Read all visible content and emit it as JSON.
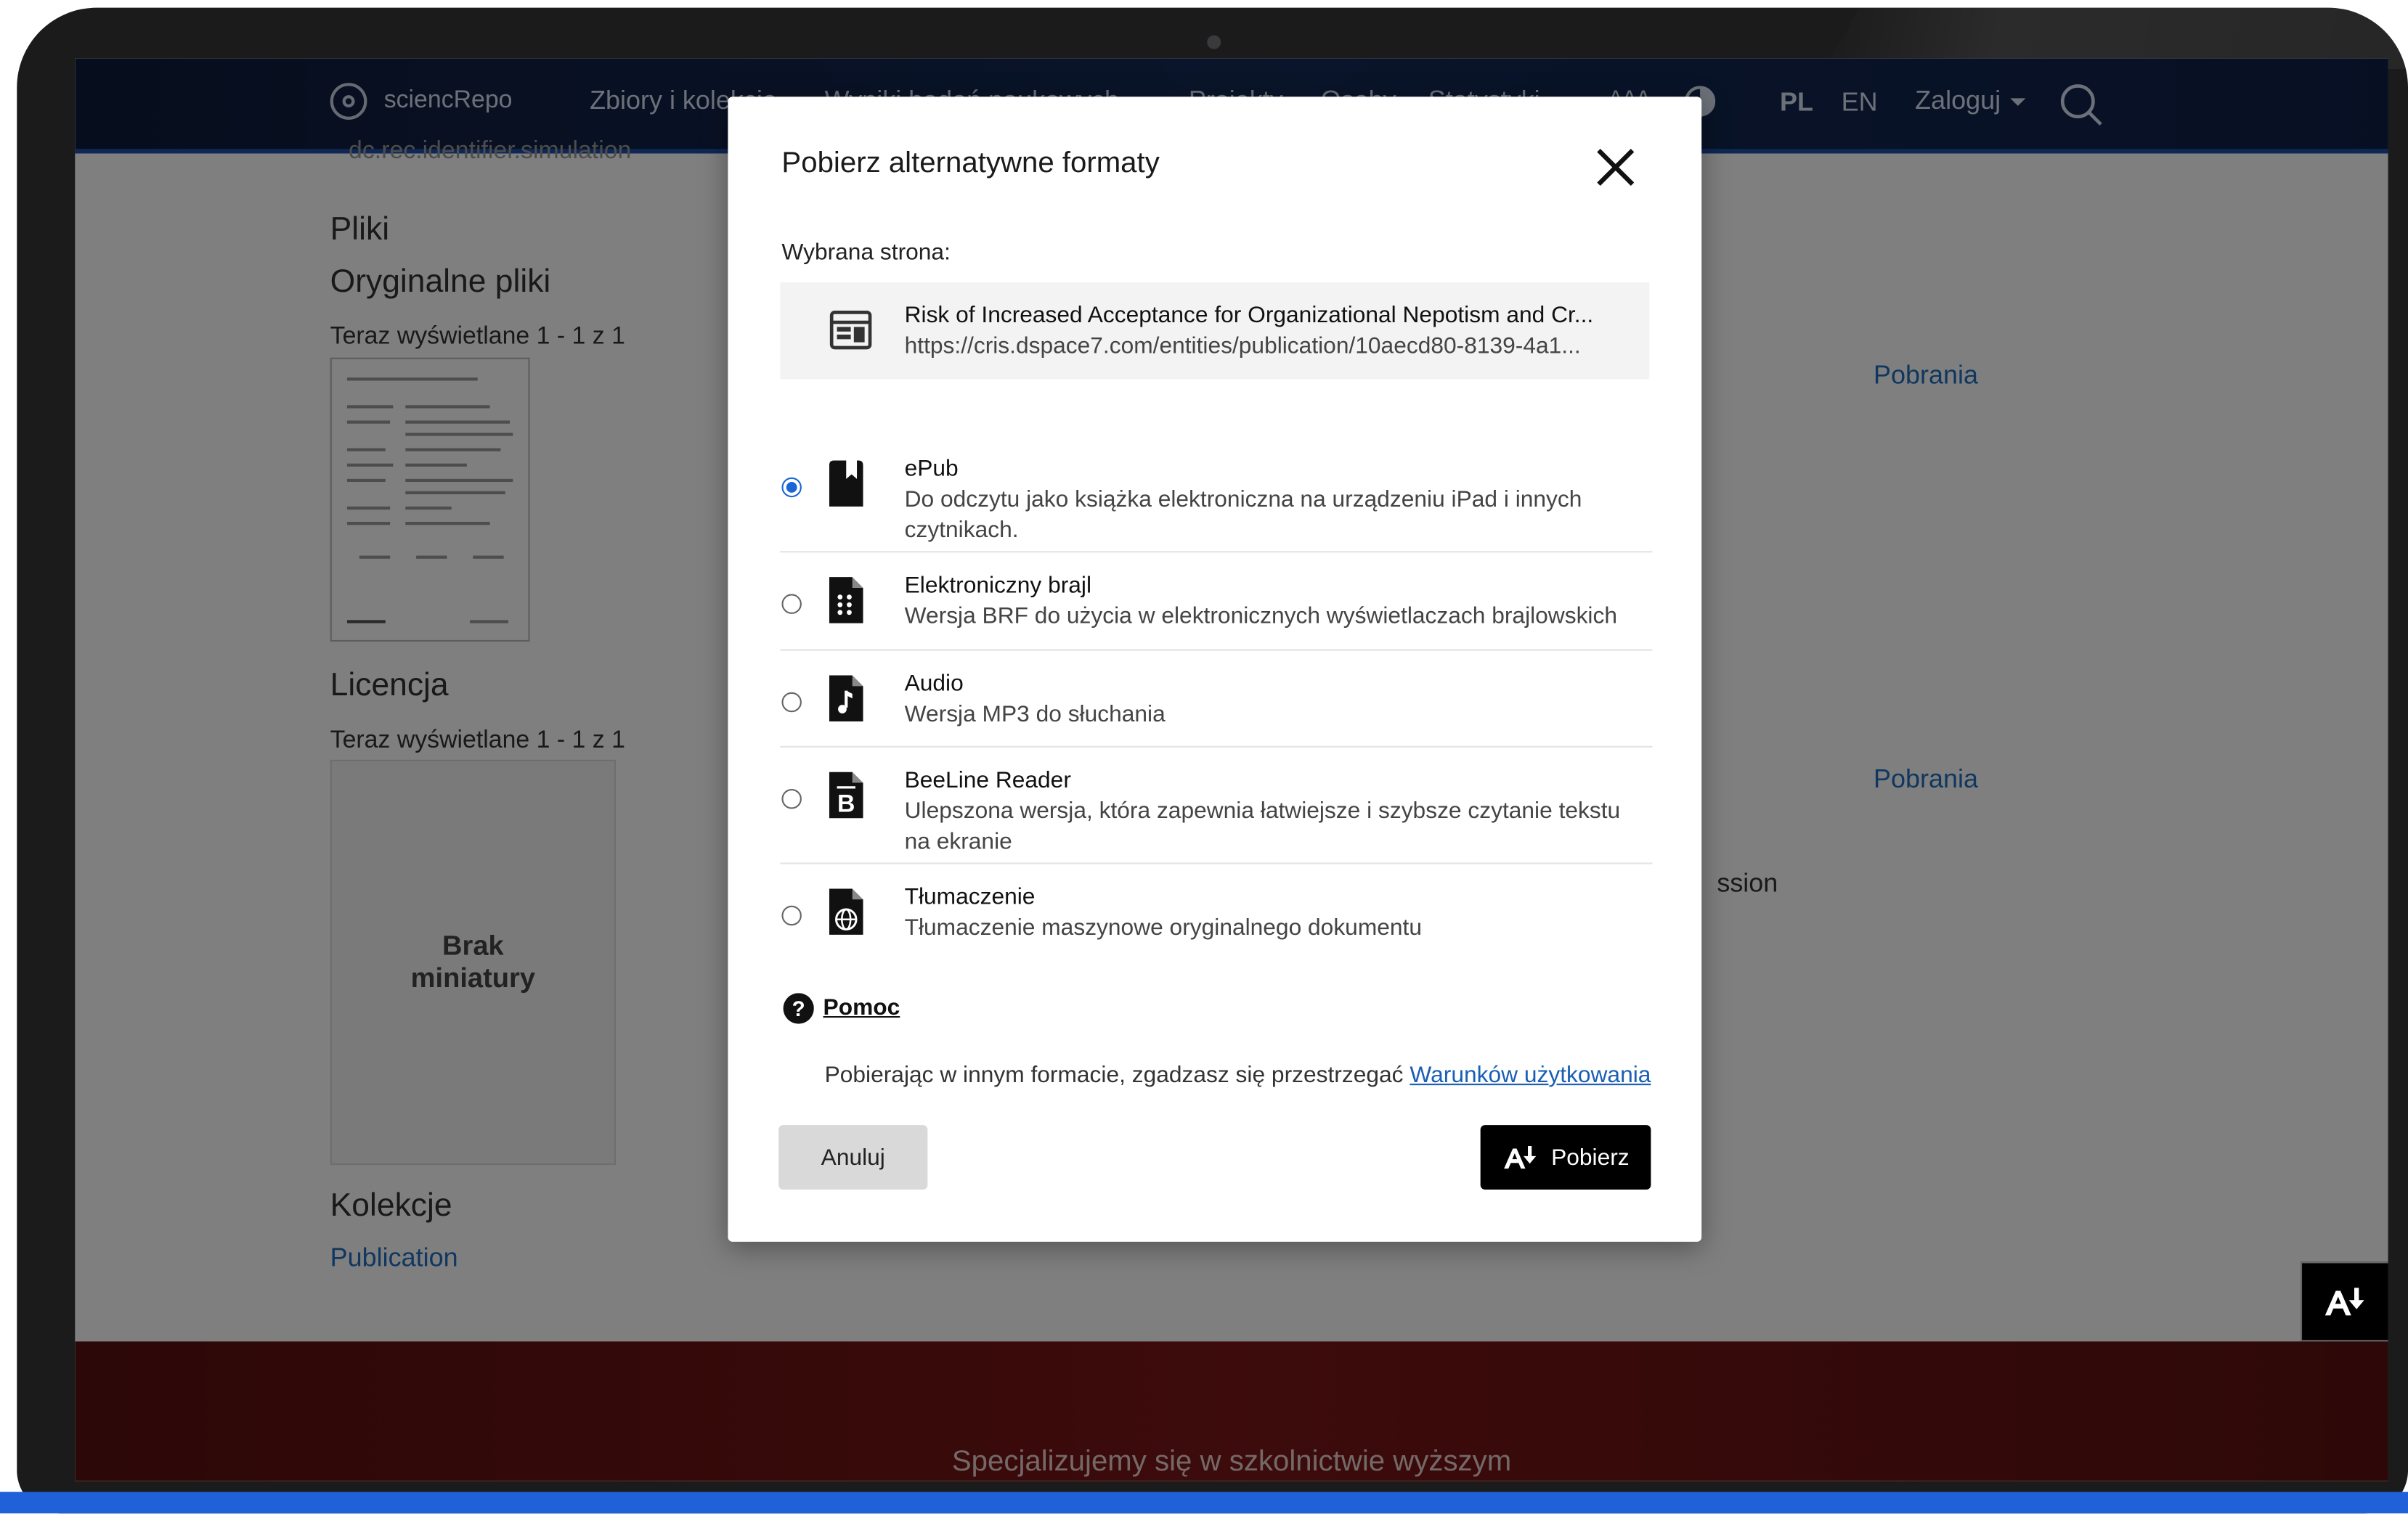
{
  "header": {
    "logo_text": "sciencRepo",
    "nav": [
      {
        "label": "Zbiory i kolekcje"
      },
      {
        "label": "Wyniki badań naukowych"
      },
      {
        "label": "Projekty"
      },
      {
        "label": "Osoby"
      },
      {
        "label": "Statystyki"
      }
    ],
    "font_size_glyph": "AAA",
    "lang_pl": "PL",
    "lang_en": "EN",
    "login": "Zaloguj"
  },
  "page": {
    "cutoff_text": "dc.rec.identifier.simulation",
    "files_heading": "Pliki",
    "original_files_heading": "Oryginalne pliki",
    "showing_1": "Teraz wyświetlane 1 - 1 z 1",
    "license_heading": "Licencja",
    "showing_2": "Teraz wyświetlane 1 - 1 z 1",
    "no_thumbnail": "Brak miniatury",
    "collections_heading": "Kolekcje",
    "collection_link": "Publication",
    "downloads_1": "Pobrania",
    "downloads_2": "Pobrania",
    "partial_text": "ssion"
  },
  "footer": {
    "tagline": "Specjalizujemy się w szkolnictwie wyższym"
  },
  "modal": {
    "title": "Pobierz alternatywne formaty",
    "selected_page_label": "Wybrana strona:",
    "selected_page": {
      "title": "Risk of Increased Acceptance for Organizational Nepotism and Cr...",
      "url": "https://cris.dspace7.com/entities/publication/10aecd80-8139-4a1..."
    },
    "options": [
      {
        "name": "ePub",
        "desc": "Do odczytu jako książka elektroniczna na urządzeniu iPad i innych czytnikach.",
        "selected": true,
        "icon": "bookmark-icon"
      },
      {
        "name": "Elektroniczny brajl",
        "desc": "Wersja BRF do użycia w elektronicznych wyświetlaczach brajlowskich",
        "selected": false,
        "icon": "braille-file-icon"
      },
      {
        "name": "Audio",
        "desc": "Wersja MP3 do słuchania",
        "selected": false,
        "icon": "audio-file-icon"
      },
      {
        "name": "BeeLine Reader",
        "desc": "Ulepszona wersja, która zapewnia łatwiejsze i szybsze czytanie tekstu na ekranie",
        "selected": false,
        "icon": "beeline-file-icon"
      },
      {
        "name": "Tłumaczenie",
        "desc": "Tłumaczenie maszynowe oryginalnego dokumentu",
        "selected": false,
        "icon": "translate-file-icon"
      }
    ],
    "help_label": "Pomoc",
    "terms_prefix": "Pobierając w innym formacie, zgadzasz się przestrzegać",
    "terms_link": "Warunków użytkowania",
    "cancel_label": "Anuluj",
    "download_label": "Pobierz"
  },
  "colors": {
    "accent": "#1a66d6",
    "primary_button": "#000000",
    "link": "#1a5fb4"
  }
}
